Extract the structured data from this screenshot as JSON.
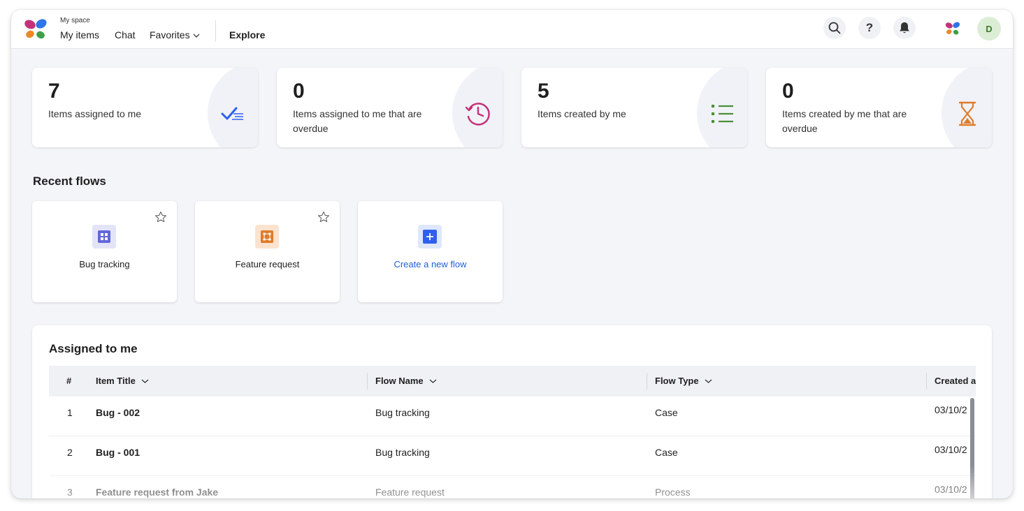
{
  "header": {
    "caption": "My space",
    "nav": {
      "my_items": "My items",
      "chat": "Chat",
      "favorites": "Favorites",
      "explore": "Explore"
    },
    "help_label": "?",
    "avatar_initial": "D"
  },
  "stats": [
    {
      "value": "7",
      "label": "Items assigned to me",
      "icon": "checklist-icon",
      "color": "#2f5ff0"
    },
    {
      "value": "0",
      "label": "Items assigned to me that are overdue",
      "icon": "history-clock-icon",
      "color": "#c4307a"
    },
    {
      "value": "5",
      "label": "Items created by me",
      "icon": "list-icon",
      "color": "#4a8f3a"
    },
    {
      "value": "0",
      "label": "Items created by me that are overdue",
      "icon": "hourglass-icon",
      "color": "#e07b2a"
    }
  ],
  "recent_flows": {
    "title": "Recent flows",
    "items": [
      {
        "name": "Bug tracking",
        "icon": "grid-icon",
        "color": "#6367d8"
      },
      {
        "name": "Feature request",
        "icon": "nodes-icon",
        "color": "#e07b2a"
      },
      {
        "name": "Create a new flow",
        "icon": "plus-icon",
        "color": "#2f5ff0"
      }
    ]
  },
  "assigned": {
    "title": "Assigned to me",
    "columns": [
      "#",
      "Item Title",
      "Flow Name",
      "Flow Type",
      "Created a"
    ],
    "rows": [
      {
        "num": "1",
        "title": "Bug - 002",
        "flow": "Bug tracking",
        "type": "Case",
        "created": "03/10/2"
      },
      {
        "num": "2",
        "title": "Bug - 001",
        "flow": "Bug tracking",
        "type": "Case",
        "created": "03/10/2"
      },
      {
        "num": "3",
        "title": "Feature request from Jake",
        "flow": "Feature request",
        "type": "Process",
        "created": "03/10/2"
      }
    ]
  }
}
